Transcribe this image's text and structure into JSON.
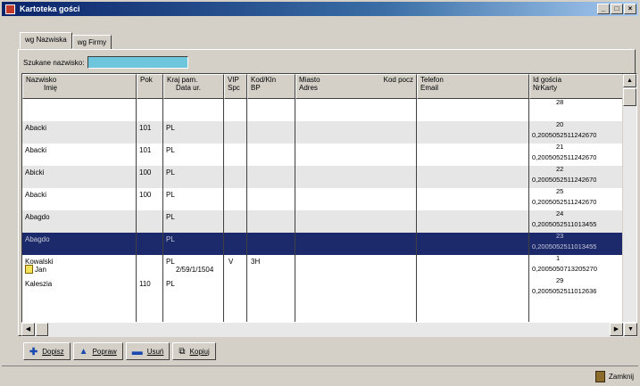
{
  "window": {
    "title": "Kartoteka gości",
    "buttons": [
      "_",
      "□",
      "×"
    ]
  },
  "tabs": [
    {
      "label": "wg Nazwiska",
      "active": true
    },
    {
      "label": "wg Firmy",
      "active": false
    }
  ],
  "search": {
    "label": "Szukane nazwisko:",
    "value": ""
  },
  "columns": [
    {
      "line1": "Nazwisko",
      "line2": "Imię"
    },
    {
      "line1": "Pok",
      "line2": ""
    },
    {
      "line1": "Kraj pam.",
      "line2": "Data ur."
    },
    {
      "line1": "VIP",
      "line2": "Spc"
    },
    {
      "line1": "Kod/Kln",
      "line2": "BP"
    },
    {
      "line1": "Miasto",
      "line2": "Adres",
      "extra": "Kod pocz"
    },
    {
      "line1": "Telefon",
      "line2": "Email"
    },
    {
      "line1": "Id gościa",
      "line2": "NrKarty"
    }
  ],
  "rows": [
    {
      "name": "",
      "pok": "",
      "kraj": "",
      "vip": "",
      "kod": "",
      "id1": "28",
      "id2": "",
      "style": "plain"
    },
    {
      "name": "Abacki",
      "pok": "101",
      "kraj": "PL",
      "vip": "",
      "kod": "",
      "id1": "20",
      "id2": "0,2005052511242670",
      "style": "grey"
    },
    {
      "name": "Abacki",
      "pok": "101",
      "kraj": "PL",
      "vip": "",
      "kod": "",
      "id1": "21",
      "id2": "0,2005052511242670",
      "style": "plain"
    },
    {
      "name": "Abicki",
      "pok": "100",
      "kraj": "PL",
      "vip": "",
      "kod": "",
      "id1": "22",
      "id2": "0,2005052511242670",
      "style": "grey"
    },
    {
      "name": "Abacki",
      "pok": "100",
      "kraj": "PL",
      "vip": "",
      "kod": "",
      "id1": "25",
      "id2": "0,2005052511242670",
      "style": "plain"
    },
    {
      "name": "Abagdo",
      "pok": "",
      "kraj": "PL",
      "vip": "",
      "kod": "",
      "id1": "24",
      "id2": "0,2005052511013455",
      "style": "grey"
    },
    {
      "name": "Abagdo",
      "pok": "",
      "kraj": "PL",
      "vip": "",
      "kod": "",
      "id1": "23",
      "id2": "0,2005052511013455",
      "style": "selected"
    },
    {
      "name": "Kowalski",
      "name2": "Jan",
      "pok": "",
      "kraj": "PL",
      "kraj2": "2/59/1/1504",
      "vip": "V",
      "kod": "3H",
      "id1": "1",
      "id2": "0,2005050713205270",
      "style": "plain"
    },
    {
      "name": "Kaleszia",
      "pok": "110",
      "kraj": "PL",
      "vip": "",
      "kod": "",
      "id1": "29",
      "id2": "0,2005052511012636",
      "style": "plain"
    }
  ],
  "toolbar": [
    {
      "label": "Dopisz",
      "icon": "plus-icon"
    },
    {
      "label": "Popraw",
      "icon": "edit-icon"
    },
    {
      "label": "Usuń",
      "icon": "minus-icon"
    },
    {
      "label": "Kopiuj",
      "icon": "copy-icon"
    }
  ],
  "status": {
    "close_label": "Zamknij"
  }
}
